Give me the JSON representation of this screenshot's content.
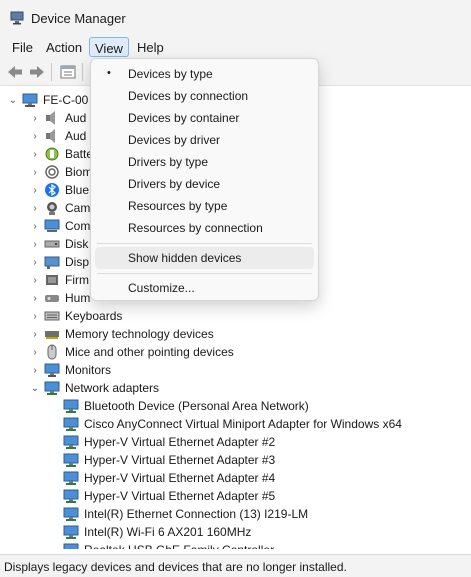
{
  "window": {
    "title": "Device Manager"
  },
  "menubar": {
    "file": "File",
    "action": "Action",
    "view": "View",
    "help": "Help"
  },
  "tree": {
    "root": "FE-C-00",
    "categories_partial": [
      {
        "label": "Aud",
        "icon": "speaker-icon"
      },
      {
        "label": "Aud",
        "icon": "speaker-icon"
      },
      {
        "label": "Batte",
        "icon": "battery-icon"
      },
      {
        "label": "Biom",
        "icon": "biometric-icon"
      },
      {
        "label": "Blue",
        "icon": "bluetooth-icon"
      },
      {
        "label": "Cam",
        "icon": "camera-icon"
      },
      {
        "label": "Com",
        "icon": "computer-icon"
      },
      {
        "label": "Disk",
        "icon": "disk-drive-icon"
      },
      {
        "label": "Disp",
        "icon": "display-adapter-icon"
      },
      {
        "label": "Firm",
        "icon": "firmware-icon"
      },
      {
        "label": "Hum",
        "icon": "human-interface-icon"
      }
    ],
    "categories": [
      {
        "label": "Keyboards",
        "icon": "keyboard-icon"
      },
      {
        "label": "Memory technology devices",
        "icon": "memory-icon"
      },
      {
        "label": "Mice and other pointing devices",
        "icon": "mouse-icon"
      },
      {
        "label": "Monitors",
        "icon": "monitor-icon"
      },
      {
        "label": "Network adapters",
        "icon": "network-adapter-icon"
      }
    ],
    "network_adapters": [
      "Bluetooth Device (Personal Area Network)",
      "Cisco AnyConnect Virtual Miniport Adapter for Windows x64",
      "Hyper-V Virtual Ethernet Adapter #2",
      "Hyper-V Virtual Ethernet Adapter #3",
      "Hyper-V Virtual Ethernet Adapter #4",
      "Hyper-V Virtual Ethernet Adapter #5",
      "Intel(R) Ethernet Connection (13) I219-LM",
      "Intel(R) Wi-Fi 6 AX201 160MHz",
      "Realtek USB GbE Family Controller"
    ]
  },
  "view_menu": {
    "items": [
      {
        "label": "Devices by type",
        "checked": true
      },
      {
        "label": "Devices by connection",
        "checked": false
      },
      {
        "label": "Devices by container",
        "checked": false
      },
      {
        "label": "Devices by driver",
        "checked": false
      },
      {
        "label": "Drivers by type",
        "checked": false
      },
      {
        "label": "Drivers by device",
        "checked": false
      },
      {
        "label": "Resources by type",
        "checked": false
      },
      {
        "label": "Resources by connection",
        "checked": false
      }
    ],
    "show_hidden": "Show hidden devices",
    "customize": "Customize...",
    "bullet": "•"
  },
  "status": {
    "text": "Displays legacy devices and devices that are no longer installed."
  },
  "colors": {
    "accent": "#0067c0",
    "selected_menu_bg": "#dfecf8",
    "menu_hover": "#ececec"
  }
}
